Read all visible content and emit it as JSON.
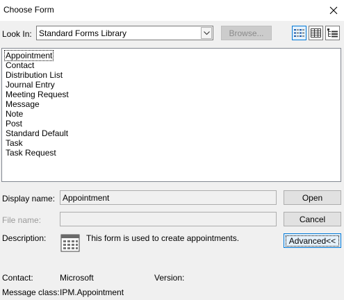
{
  "window": {
    "title": "Choose Form",
    "close_glyph": "✕"
  },
  "look_in": {
    "label": "Look In:",
    "value": "Standard Forms Library",
    "arrow_glyph": "⌄",
    "browse_label": "Browse..."
  },
  "view_buttons": [
    {
      "icon": "list-view-icon",
      "active": true
    },
    {
      "icon": "details-view-icon",
      "active": false
    },
    {
      "icon": "tree-view-icon",
      "active": false
    }
  ],
  "forms": [
    "Appointment",
    "Contact",
    "Distribution List",
    "Journal Entry",
    "Meeting Request",
    "Message",
    "Note",
    "Post",
    "Standard Default",
    "Task",
    "Task Request"
  ],
  "selected_form": "Appointment",
  "display_name": {
    "label": "Display name:",
    "value": "Appointment"
  },
  "file_name": {
    "label": "File name:",
    "value": ""
  },
  "description": {
    "label": "Description:",
    "icon": "calendar-form-icon",
    "text": "This form is used to create appointments."
  },
  "buttons": {
    "open": "Open",
    "cancel": "Cancel",
    "advanced": "Advanced<<"
  },
  "info": {
    "contact_label": "Contact:",
    "contact_value": "Microsoft",
    "version_label": "Version:",
    "version_value": "",
    "message_class_label": "Message class:",
    "message_class_value": "IPM.Appointment"
  },
  "colors": {
    "accent": "#0078d7",
    "dialog_bg": "#f0f0f0"
  }
}
